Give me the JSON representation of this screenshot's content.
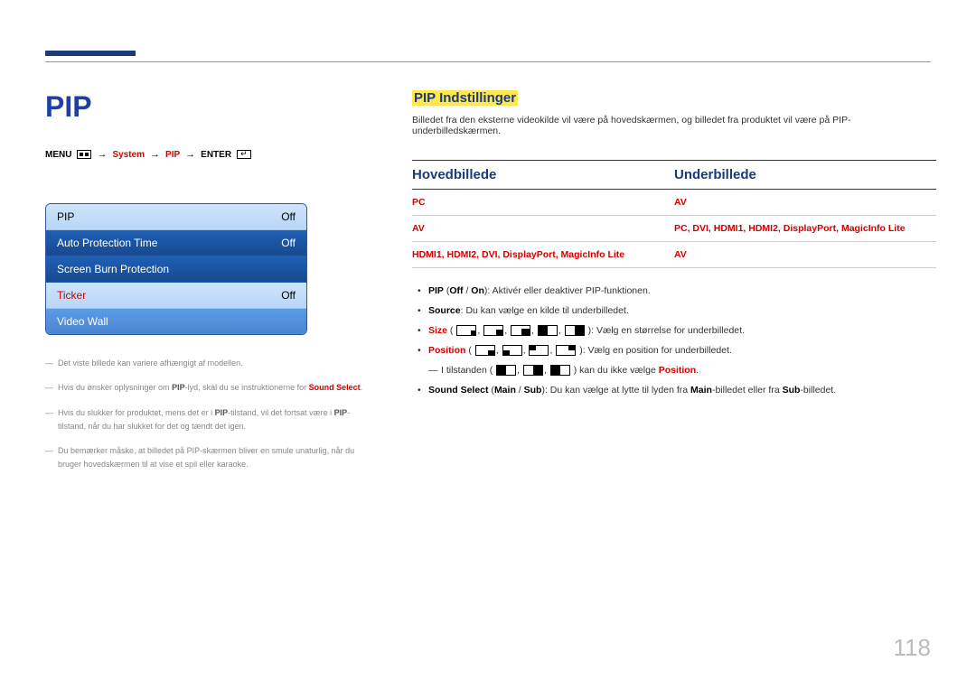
{
  "page_number": "118",
  "left": {
    "title": "PIP",
    "breadcrumb": {
      "menu": "MENU",
      "system": "System",
      "pip": "PIP",
      "enter": "ENTER"
    },
    "menu": [
      {
        "label": "PIP",
        "value": "Off",
        "style": "light",
        "red_label": false
      },
      {
        "label": "Auto Protection Time",
        "value": "Off",
        "style": "dark",
        "red_label": false
      },
      {
        "label": "Screen Burn Protection",
        "value": "",
        "style": "dark",
        "red_label": false
      },
      {
        "label": "Ticker",
        "value": "Off",
        "style": "light",
        "red_label": true
      },
      {
        "label": "Video Wall",
        "value": "",
        "style": "mid",
        "red_label": false
      }
    ],
    "notes": {
      "n1": "Det viste billede kan variere afhængigt af modellen.",
      "n2_a": "Hvis du ønsker oplysninger om ",
      "n2_b": "PIP",
      "n2_c": "-lyd, skal du se instruktionerne for ",
      "n2_d": "Sound Select",
      "n2_e": ".",
      "n3_a": "Hvis du slukker for produktet, mens det er i ",
      "n3_b": "PIP",
      "n3_c": "-tilstand, vil det fortsat være i ",
      "n3_d": "PIP",
      "n3_e": "-tilstand, når du har slukket for det og tændt det igen.",
      "n4": "Du bemærker måske, at billedet på PIP-skærmen bliver en smule unaturlig, når du bruger hovedskærmen til at vise et spil eller karaoke."
    }
  },
  "right": {
    "heading": "PIP Indstillinger",
    "intro": "Billedet fra den eksterne videokilde vil være på hovedskærmen, og billedet fra produktet vil være på PIP-underbilledskærmen.",
    "table": {
      "h1": "Hovedbillede",
      "h2": "Underbillede",
      "rows": [
        {
          "c1": "PC",
          "c2": "AV"
        },
        {
          "c1": "AV",
          "c2": "PC, DVI, HDMI1, HDMI2, DisplayPort, MagicInfo Lite"
        },
        {
          "c1": "HDMI1, HDMI2, DVI, DisplayPort, MagicInfo Lite",
          "c2": "AV"
        }
      ]
    },
    "bullets": {
      "b1_a": "PIP",
      "b1_b": " (",
      "b1_c": "Off",
      "b1_d": " / ",
      "b1_e": "On",
      "b1_f": "): Aktivér eller deaktiver PIP-funktionen.",
      "b2_a": "Source",
      "b2_b": ": Du kan vælge en kilde til underbilledet.",
      "b3_a": "Size",
      "b3_b": " (",
      "b3_c": "): Vælg en størrelse for underbilledet.",
      "b4_a": "Position",
      "b4_b": " (",
      "b4_c": "): Vælg en position for underbilledet.",
      "b4s_a": "I tilstanden (",
      "b4s_b": ") kan du ikke vælge ",
      "b4s_c": "Position",
      "b4s_d": ".",
      "b5_a": "Sound Select",
      "b5_b": " (",
      "b5_c": "Main",
      "b5_d": " / ",
      "b5_e": "Sub",
      "b5_f": "): Du kan vælge at lytte til lyden fra ",
      "b5_g": "Main",
      "b5_h": "-billedet eller fra ",
      "b5_i": "Sub",
      "b5_j": "-billedet."
    }
  }
}
